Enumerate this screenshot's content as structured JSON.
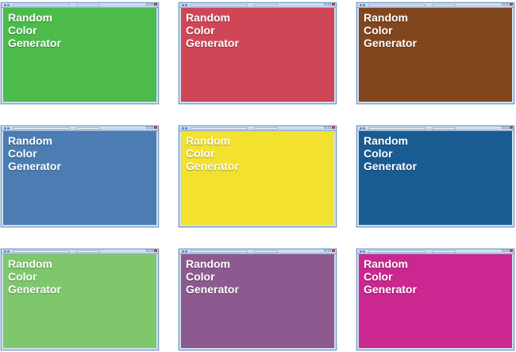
{
  "title_lines": [
    "Random",
    "Color",
    "Generator"
  ],
  "windows": [
    {
      "bg": "#4cbb4a"
    },
    {
      "bg": "#cf4657"
    },
    {
      "bg": "#82461f"
    },
    {
      "bg": "#4b7db3"
    },
    {
      "bg": "#f2e22f"
    },
    {
      "bg": "#195c92"
    },
    {
      "bg": "#7ec86b"
    },
    {
      "bg": "#8c5a8e"
    },
    {
      "bg": "#ca2790"
    }
  ]
}
